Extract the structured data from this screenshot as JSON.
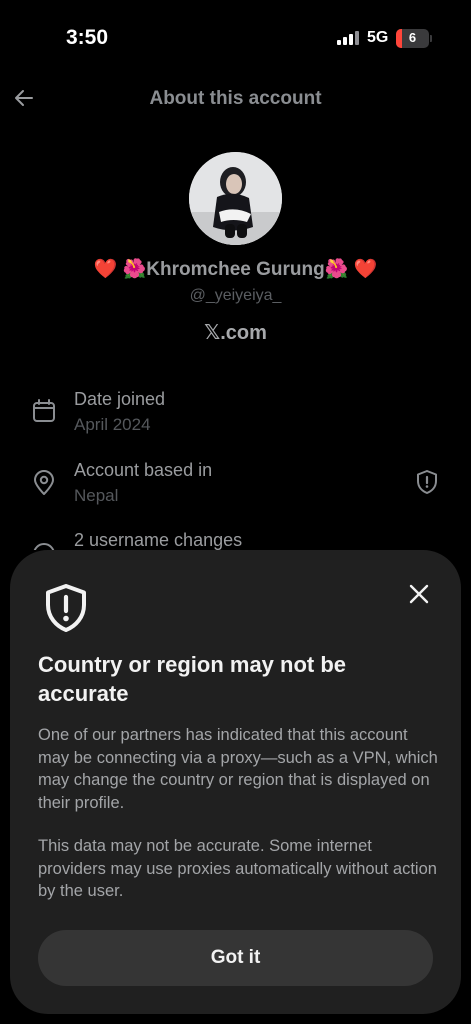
{
  "status_bar": {
    "time": "3:50",
    "network": "5G",
    "battery": "6"
  },
  "header": {
    "title": "About this account"
  },
  "profile": {
    "display_name": "❤️ 🌺Khromchee Gurung🌺 ❤️",
    "handle": "@_yeiyeiya_",
    "source": "𝕏.com"
  },
  "info_rows": [
    {
      "title": "Date joined",
      "value": "April 2024",
      "icon": "calendar-icon"
    },
    {
      "title": "Account based in",
      "value": "Nepal",
      "icon": "location-pin-icon"
    },
    {
      "title": "2 username changes",
      "value": "",
      "icon": "history-icon"
    }
  ],
  "sheet": {
    "title": "Country or region may not be accurate",
    "paragraph1": "One of our partners has indicated that this account may be connecting via a proxy—such as a VPN, which may change the country or region that is displayed on their profile.",
    "paragraph2": "This data may not be accurate. Some internet providers may use proxies automatically without action by the user.",
    "button": "Got it"
  },
  "colors": {
    "background": "#000000",
    "sheet": "#202020",
    "button": "#353535",
    "battery_low": "#ff453a"
  }
}
